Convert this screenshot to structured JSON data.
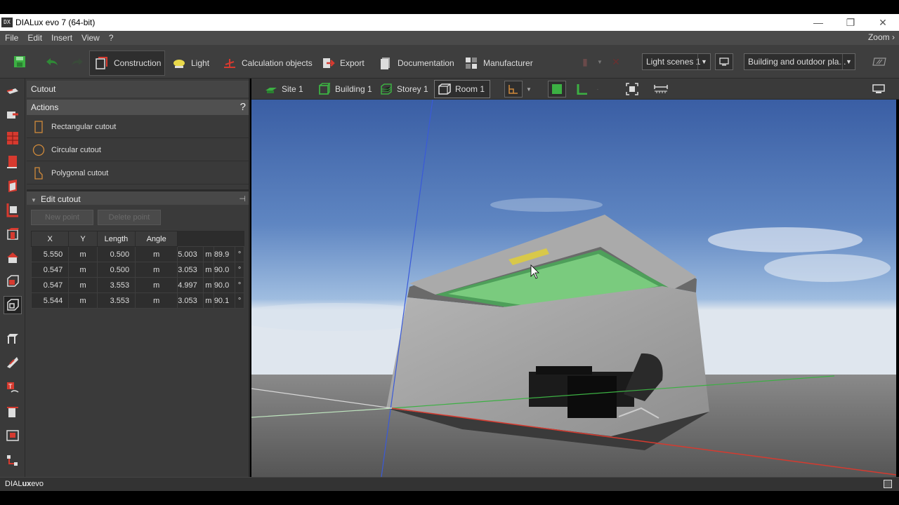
{
  "window": {
    "app_icon": "DX",
    "title": "DIALux evo 7  (64-bit)"
  },
  "menu": {
    "items": [
      "File",
      "Edit",
      "Insert",
      "View",
      "?"
    ],
    "zoom_label": "Zoom"
  },
  "toolbar": {
    "tabs": {
      "construction": "Construction",
      "light": "Light",
      "calculation": "Calculation objects",
      "export": "Export",
      "documentation": "Documentation",
      "manufacturer": "Manufacturer"
    },
    "light_scenes": "Light scenes 1",
    "building_select": "Building and outdoor pla..."
  },
  "panel": {
    "header": "Cutout",
    "actions_title": "Actions",
    "help": "?",
    "actions": {
      "rectangular": "Rectangular cutout",
      "circular": "Circular cutout",
      "polygonal": "Polygonal cutout"
    },
    "edit_title": "Edit cutout",
    "new_point": "New point",
    "delete_point": "Delete point",
    "table": {
      "headers": [
        "X",
        "Y",
        "Length",
        "Angle"
      ],
      "rows": [
        {
          "x": "5.550",
          "y": "0.500",
          "length": "5.003",
          "angle": "89.9"
        },
        {
          "x": "0.547",
          "y": "0.500",
          "length": "3.053",
          "angle": "90.0"
        },
        {
          "x": "0.547",
          "y": "3.553",
          "length": "4.997",
          "angle": "90.0"
        },
        {
          "x": "5.544",
          "y": "3.553",
          "length": "3.053",
          "angle": "90.1"
        }
      ],
      "unit": "m",
      "deg": "°"
    }
  },
  "viewport": {
    "breadcrumbs": {
      "site": "Site 1",
      "building": "Building 1",
      "storey": "Storey 1",
      "room": "Room 1"
    }
  },
  "status": {
    "brand_pre": "DIAL",
    "brand_bold": "ux",
    "brand_post": "evo"
  },
  "colors": {
    "accent_red": "#d63a2f",
    "accent_green": "#3cb043",
    "accent_orange": "#d08a3a"
  }
}
